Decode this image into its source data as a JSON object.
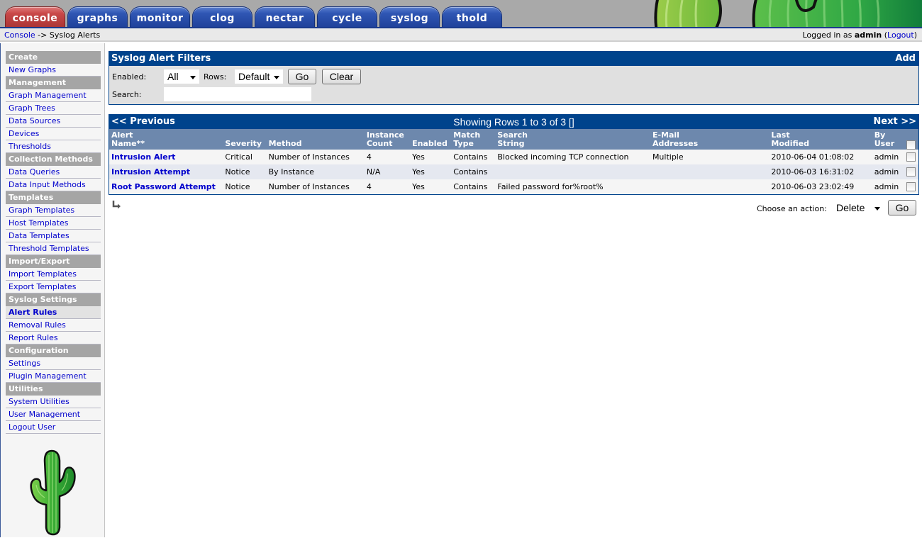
{
  "tabs": [
    {
      "label": "console",
      "active": true
    },
    {
      "label": "graphs",
      "active": false
    },
    {
      "label": "monitor",
      "active": false
    },
    {
      "label": "clog",
      "active": false
    },
    {
      "label": "nectar",
      "active": false
    },
    {
      "label": "cycle",
      "active": false
    },
    {
      "label": "syslog",
      "active": false
    },
    {
      "label": "thold",
      "active": false
    }
  ],
  "breadcrumb": {
    "root": "Console",
    "separator": "->",
    "current": "Syslog Alerts"
  },
  "login": {
    "prefix": "Logged in as",
    "user": "admin",
    "open_paren": "(",
    "logout": "Logout",
    "close_paren": ")"
  },
  "sidebar": {
    "sections": [
      {
        "header": "Create",
        "items": [
          "New Graphs"
        ]
      },
      {
        "header": "Management",
        "items": [
          "Graph Management",
          "Graph Trees",
          "Data Sources",
          "Devices",
          "Thresholds"
        ]
      },
      {
        "header": "Collection Methods",
        "items": [
          "Data Queries",
          "Data Input Methods"
        ]
      },
      {
        "header": "Templates",
        "items": [
          "Graph Templates",
          "Host Templates",
          "Data Templates",
          "Threshold Templates"
        ]
      },
      {
        "header": "Import/Export",
        "items": [
          "Import Templates",
          "Export Templates"
        ]
      },
      {
        "header": "Syslog Settings",
        "items": [
          "Alert Rules",
          "Removal Rules",
          "Report Rules"
        ]
      },
      {
        "header": "Configuration",
        "items": [
          "Settings",
          "Plugin Management"
        ]
      },
      {
        "header": "Utilities",
        "items": [
          "System Utilities",
          "User Management",
          "Logout User"
        ]
      }
    ],
    "selected_item": "Alert Rules"
  },
  "filters": {
    "title": "Syslog Alert Filters",
    "add_label": "Add",
    "enabled_label": "Enabled:",
    "enabled_value": "All",
    "rows_label": "Rows:",
    "rows_value": "Default",
    "go_label": "Go",
    "clear_label": "Clear",
    "search_label": "Search:",
    "search_value": ""
  },
  "results": {
    "prev_label": "<< Previous",
    "next_label": "Next >>",
    "showing": "Showing Rows 1 to 3 of 3 []",
    "columns": [
      {
        "line1": "Alert",
        "line2": "Name**"
      },
      {
        "line1": "",
        "line2": "Severity"
      },
      {
        "line1": "",
        "line2": "Method"
      },
      {
        "line1": "Instance",
        "line2": "Count"
      },
      {
        "line1": "",
        "line2": "Enabled"
      },
      {
        "line1": "Match",
        "line2": "Type"
      },
      {
        "line1": "Search",
        "line2": "String"
      },
      {
        "line1": "E-Mail",
        "line2": "Addresses"
      },
      {
        "line1": "Last",
        "line2": "Modified"
      },
      {
        "line1": "By",
        "line2": "User"
      }
    ],
    "rows": [
      {
        "name": "Intrusion Alert",
        "severity": "Critical",
        "method": "Number of Instances",
        "count": "4",
        "enabled": "Yes",
        "match": "Contains",
        "search": "Blocked incoming TCP connection",
        "email": "Multiple",
        "modified": "2010-06-04 01:08:02",
        "user": "admin",
        "checked": false
      },
      {
        "name": "Intrusion Attempt",
        "severity": "Notice",
        "method": "By Instance",
        "count": "N/A",
        "enabled": "Yes",
        "match": "Contains",
        "search": "",
        "email": "",
        "modified": "2010-06-03 16:31:02",
        "user": "admin",
        "checked": false
      },
      {
        "name": "Root Password Attempt",
        "severity": "Notice",
        "method": "Number of Instances",
        "count": "4",
        "enabled": "Yes",
        "match": "Contains",
        "search": "Failed password for%root%",
        "email": "",
        "modified": "2010-06-03 23:02:49",
        "user": "admin",
        "checked": false
      }
    ]
  },
  "actions": {
    "label": "Choose an action:",
    "value": "Delete",
    "go_label": "Go"
  },
  "colors": {
    "header_blue": "#00438c",
    "column_header": "#6d88ad",
    "tab_active": "#c94848",
    "tab_inactive": "#2f56b3",
    "link": "#0000cc",
    "menu_header": "#a5a5a5"
  }
}
